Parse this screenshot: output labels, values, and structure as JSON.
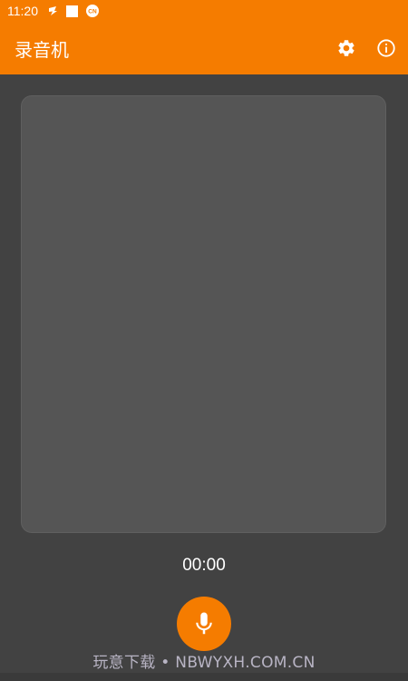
{
  "status_bar": {
    "time": "11:20",
    "icons": [
      "notification-app-icon",
      "square-icon",
      "cn-badge-icon"
    ]
  },
  "app_bar": {
    "title": "录音机",
    "actions": [
      "settings-icon",
      "info-icon"
    ]
  },
  "recorder": {
    "timer": "00:00",
    "record_button_icon": "microphone-icon"
  },
  "watermark": "玩意下载 • NBWYXH.COM.CN",
  "colors": {
    "accent": "#F57C00",
    "background": "#424242",
    "panel": "#555555",
    "text": "#FFFFFF"
  }
}
